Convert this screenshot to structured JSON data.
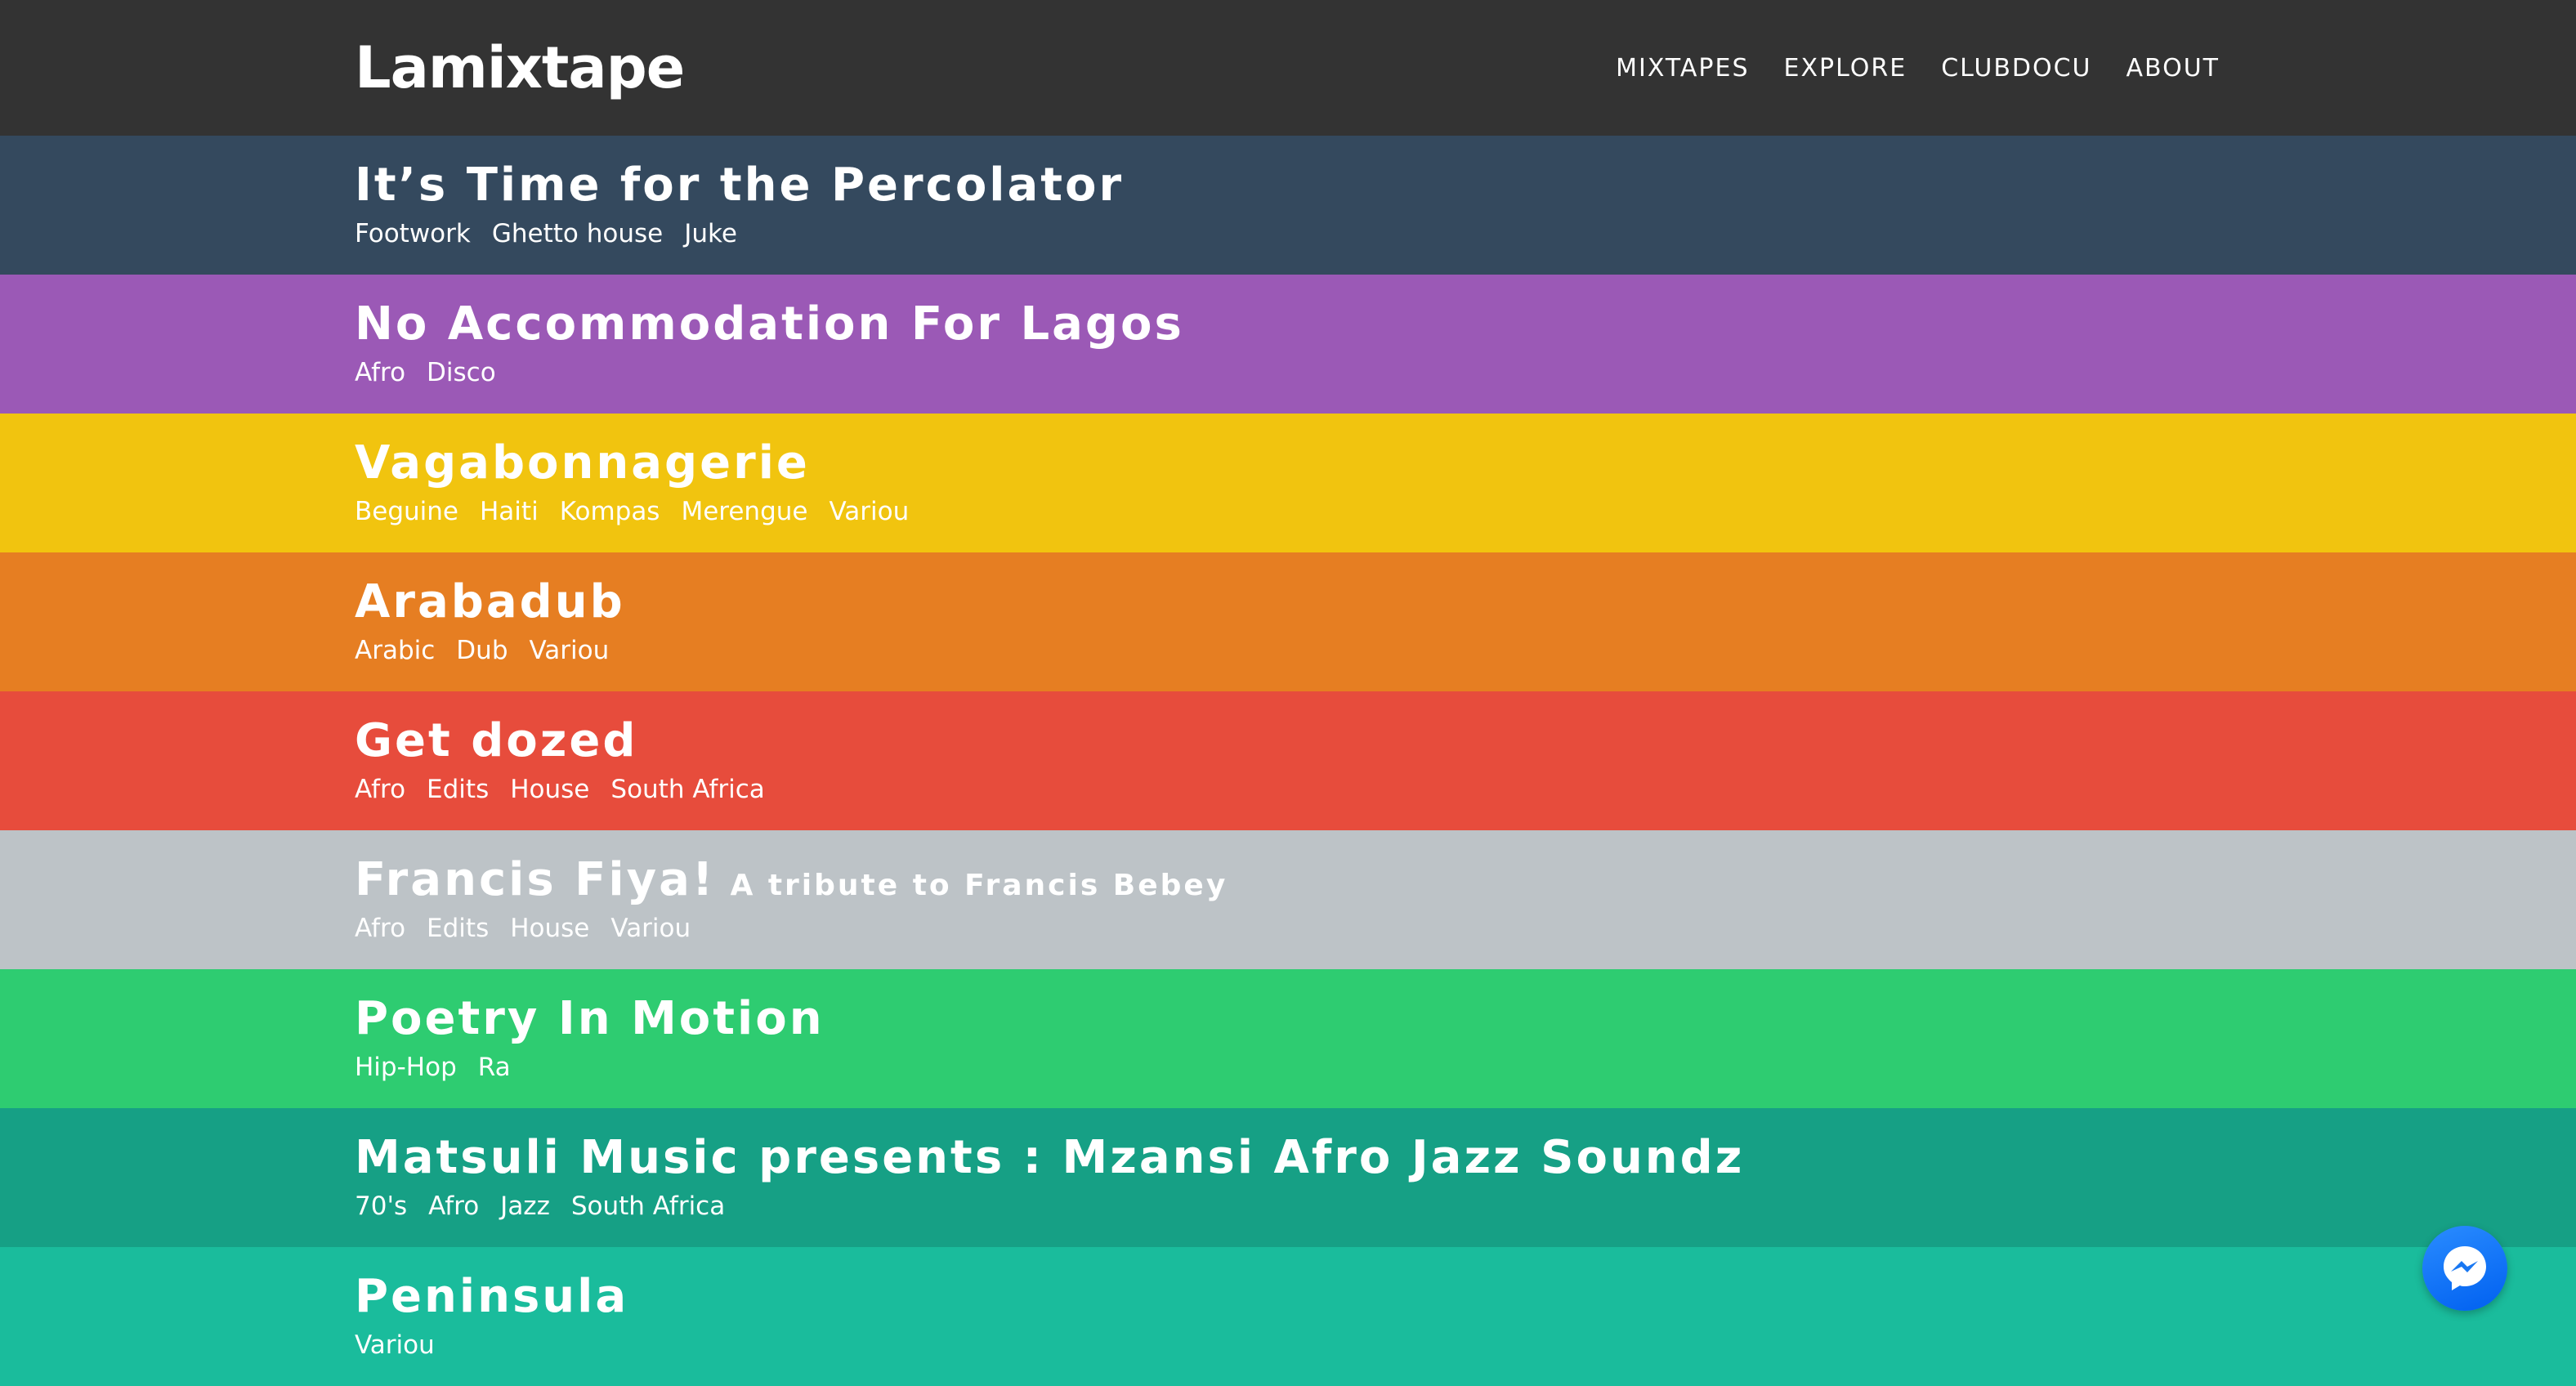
{
  "header": {
    "logo": "Lamixtape",
    "nav": [
      {
        "label": "MIXTAPES"
      },
      {
        "label": "EXPLORE"
      },
      {
        "label": "CLUBDOCU"
      },
      {
        "label": "ABOUT"
      }
    ]
  },
  "mixtapes": [
    {
      "title": "It’s Time for the Percolator",
      "subtitle": "",
      "color": "#34495e",
      "tags": [
        "Footwork",
        "Ghetto house",
        "Juke"
      ]
    },
    {
      "title": "No Accommodation For Lagos",
      "subtitle": "",
      "color": "#9b59b6",
      "tags": [
        "Afro",
        "Disco"
      ]
    },
    {
      "title": "Vagabonnagerie",
      "subtitle": "",
      "color": "#f1c40f",
      "tags": [
        "Beguine",
        "Haiti",
        "Kompas",
        "Merengue",
        "Variou"
      ]
    },
    {
      "title": "Arabadub",
      "subtitle": "",
      "color": "#e67e22",
      "tags": [
        "Arabic",
        "Dub",
        "Variou"
      ]
    },
    {
      "title": "Get dozed",
      "subtitle": "",
      "color": "#e74c3c",
      "tags": [
        "Afro",
        "Edits",
        "House",
        "South Africa"
      ]
    },
    {
      "title": "Francis Fiya!",
      "subtitle": "A tribute to Francis Bebey",
      "color": "#bdc3c7",
      "tags": [
        "Afro",
        "Edits",
        "House",
        "Variou"
      ]
    },
    {
      "title": "Poetry In Motion",
      "subtitle": "",
      "color": "#2ecc71",
      "tags": [
        "Hip-Hop",
        "Ra"
      ]
    },
    {
      "title": "Matsuli Music presents : Mzansi Afro Jazz Soundz",
      "subtitle": "",
      "color": "#16a085",
      "tags": [
        "70's",
        "Afro",
        "Jazz",
        "South Africa"
      ]
    },
    {
      "title": "Peninsula",
      "subtitle": "",
      "color": "#1abc9c",
      "tags": [
        "Variou"
      ]
    }
  ],
  "icons": {
    "messenger": "messenger-icon"
  }
}
